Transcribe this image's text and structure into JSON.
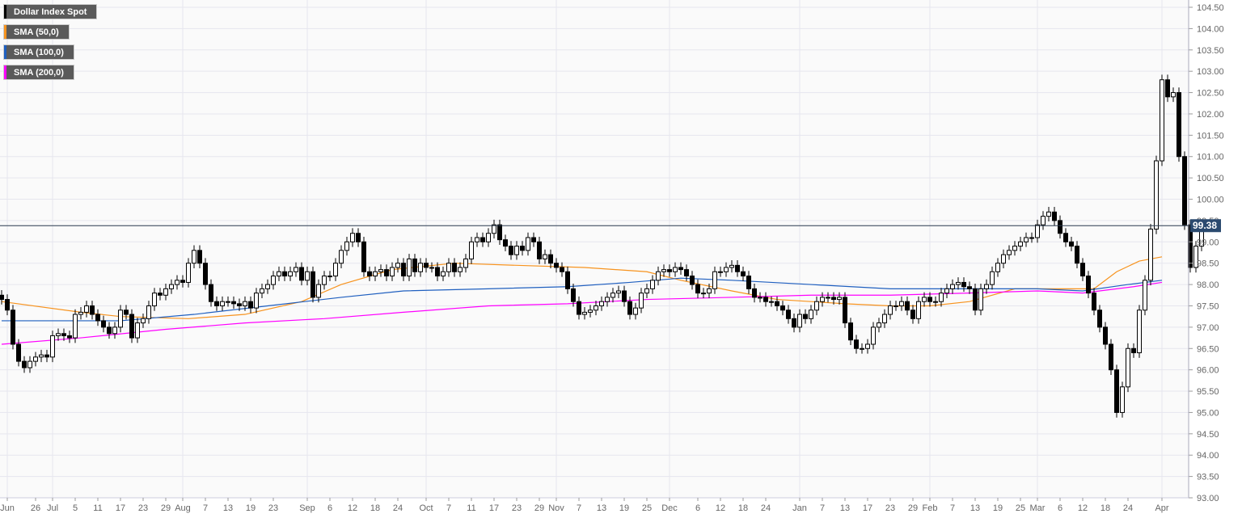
{
  "legend": [
    {
      "label": "Dollar Index Spot",
      "color": "#000000"
    },
    {
      "label": "SMA (50,0)",
      "color": "#f7931e"
    },
    {
      "label": "SMA (100,0)",
      "color": "#1f5fbf"
    },
    {
      "label": "SMA (200,0)",
      "color": "#ff00ff"
    }
  ],
  "current_price": {
    "label": "99.38",
    "value": 99.38,
    "color": "#2b4a6f"
  },
  "chart_data": {
    "type": "candlestick",
    "title": "Dollar Index Spot",
    "ylim": [
      93.0,
      104.5
    ],
    "yticks": [
      "93.00",
      "93.50",
      "94.00",
      "94.50",
      "95.00",
      "95.50",
      "96.00",
      "96.50",
      "97.00",
      "97.50",
      "98.00",
      "98.50",
      "99.00",
      "99.50",
      "100.00",
      "100.50",
      "101.00",
      "101.50",
      "102.00",
      "102.50",
      "103.00",
      "103.50",
      "104.00",
      "104.50"
    ],
    "xticks": [
      [
        "Jun",
        1
      ],
      [
        "26",
        6
      ],
      [
        "Jul",
        9
      ],
      [
        "5",
        13
      ],
      [
        "11",
        17
      ],
      [
        "17",
        21
      ],
      [
        "23",
        25
      ],
      [
        "29",
        29
      ],
      [
        "Aug",
        32
      ],
      [
        "7",
        36
      ],
      [
        "13",
        40
      ],
      [
        "19",
        44
      ],
      [
        "23",
        48
      ],
      [
        "Sep",
        54
      ],
      [
        "6",
        58
      ],
      [
        "12",
        62
      ],
      [
        "18",
        66
      ],
      [
        "24",
        70
      ],
      [
        "Oct",
        75
      ],
      [
        "7",
        79
      ],
      [
        "11",
        83
      ],
      [
        "17",
        87
      ],
      [
        "23",
        91
      ],
      [
        "29",
        95
      ],
      [
        "Nov",
        98
      ],
      [
        "7",
        102
      ],
      [
        "13",
        106
      ],
      [
        "19",
        110
      ],
      [
        "25",
        114
      ],
      [
        "Dec",
        118
      ],
      [
        "6",
        123
      ],
      [
        "12",
        127
      ],
      [
        "18",
        131
      ],
      [
        "24",
        135
      ],
      [
        "Jan",
        141
      ],
      [
        "7",
        145
      ],
      [
        "13",
        149
      ],
      [
        "17",
        153
      ],
      [
        "23",
        157
      ],
      [
        "29",
        161
      ],
      [
        "Feb",
        164
      ],
      [
        "7",
        168
      ],
      [
        "13",
        172
      ],
      [
        "19",
        176
      ],
      [
        "25",
        180
      ],
      [
        "Mar",
        183
      ],
      [
        "6",
        187
      ],
      [
        "12",
        191
      ],
      [
        "18",
        195
      ],
      [
        "24",
        199
      ],
      [
        "Apr",
        205
      ]
    ],
    "closes": [
      97.65,
      97.4,
      96.6,
      96.2,
      96.05,
      96.2,
      96.3,
      96.35,
      96.3,
      96.8,
      96.85,
      96.8,
      96.75,
      97.3,
      97.35,
      97.5,
      97.3,
      97.15,
      97.0,
      96.85,
      97.0,
      97.4,
      97.3,
      96.75,
      97.1,
      97.2,
      97.5,
      97.8,
      97.75,
      97.9,
      98.0,
      98.1,
      98.05,
      98.5,
      98.8,
      98.5,
      98.0,
      97.6,
      97.5,
      97.6,
      97.6,
      97.55,
      97.5,
      97.6,
      97.45,
      97.8,
      97.9,
      98.0,
      98.2,
      98.3,
      98.2,
      98.3,
      98.4,
      98.1,
      98.3,
      97.7,
      98.0,
      98.2,
      98.2,
      98.5,
      98.8,
      99.0,
      99.2,
      99.0,
      98.3,
      98.2,
      98.3,
      98.35,
      98.2,
      98.4,
      98.5,
      98.2,
      98.6,
      98.3,
      98.5,
      98.4,
      98.4,
      98.2,
      98.3,
      98.5,
      98.3,
      98.4,
      98.6,
      99.0,
      99.1,
      99.0,
      99.2,
      99.4,
      99.05,
      98.9,
      98.7,
      98.9,
      98.8,
      99.1,
      99.0,
      98.6,
      98.7,
      98.5,
      98.4,
      98.3,
      97.9,
      97.6,
      97.3,
      97.35,
      97.4,
      97.5,
      97.6,
      97.7,
      97.8,
      97.85,
      97.6,
      97.3,
      97.45,
      97.8,
      97.9,
      98.1,
      98.3,
      98.35,
      98.3,
      98.4,
      98.35,
      98.2,
      98.0,
      97.8,
      97.8,
      97.9,
      98.3,
      98.3,
      98.4,
      98.45,
      98.3,
      98.2,
      97.9,
      97.7,
      97.7,
      97.6,
      97.6,
      97.5,
      97.4,
      97.2,
      97.0,
      97.3,
      97.2,
      97.4,
      97.6,
      97.7,
      97.7,
      97.65,
      97.7,
      97.1,
      96.7,
      96.5,
      96.5,
      96.6,
      97.0,
      97.1,
      97.3,
      97.5,
      97.5,
      97.6,
      97.4,
      97.2,
      97.6,
      97.7,
      97.6,
      97.6,
      97.8,
      97.9,
      98.0,
      98.05,
      97.95,
      97.9,
      97.4,
      97.9,
      98.0,
      98.3,
      98.5,
      98.7,
      98.8,
      98.9,
      99.0,
      99.1,
      99.1,
      99.4,
      99.6,
      99.7,
      99.5,
      99.2,
      99.0,
      98.9,
      98.5,
      98.2,
      97.8,
      97.4,
      97.0,
      96.6,
      96.0,
      95.0,
      95.6,
      96.5,
      96.4,
      97.4,
      98.1,
      99.3,
      100.9,
      102.8,
      102.4,
      102.5,
      101.0,
      99.4,
      98.4,
      98.9,
      99.38
    ],
    "series": [
      {
        "name": "SMA (50,0)",
        "color": "#f7931e",
        "points": [
          [
            0,
            97.6
          ],
          [
            14,
            97.35
          ],
          [
            21,
            97.25
          ],
          [
            33,
            97.2
          ],
          [
            43,
            97.3
          ],
          [
            53,
            97.6
          ],
          [
            60,
            98.0
          ],
          [
            69,
            98.35
          ],
          [
            80,
            98.5
          ],
          [
            91,
            98.45
          ],
          [
            103,
            98.4
          ],
          [
            114,
            98.3
          ],
          [
            120,
            98.1
          ],
          [
            129,
            97.85
          ],
          [
            137,
            97.65
          ],
          [
            149,
            97.55
          ],
          [
            157,
            97.5
          ],
          [
            164,
            97.5
          ],
          [
            171,
            97.6
          ],
          [
            179,
            97.9
          ],
          [
            186,
            97.9
          ],
          [
            193,
            97.9
          ],
          [
            197,
            98.3
          ],
          [
            201,
            98.55
          ],
          [
            205,
            98.65
          ]
        ]
      },
      {
        "name": "SMA (100,0)",
        "color": "#1f5fbf",
        "points": [
          [
            0,
            97.15
          ],
          [
            21,
            97.15
          ],
          [
            34,
            97.3
          ],
          [
            47,
            97.5
          ],
          [
            60,
            97.7
          ],
          [
            71,
            97.85
          ],
          [
            86,
            97.9
          ],
          [
            100,
            97.95
          ],
          [
            111,
            98.05
          ],
          [
            120,
            98.15
          ],
          [
            129,
            98.1
          ],
          [
            143,
            98.0
          ],
          [
            157,
            97.9
          ],
          [
            171,
            97.9
          ],
          [
            183,
            97.9
          ],
          [
            191,
            97.85
          ],
          [
            199,
            98.0
          ],
          [
            205,
            98.1
          ]
        ]
      },
      {
        "name": "SMA (200,0)",
        "color": "#ff00ff",
        "points": [
          [
            0,
            96.6
          ],
          [
            14,
            96.75
          ],
          [
            29,
            96.95
          ],
          [
            43,
            97.1
          ],
          [
            57,
            97.2
          ],
          [
            71,
            97.35
          ],
          [
            86,
            97.5
          ],
          [
            100,
            97.55
          ],
          [
            114,
            97.65
          ],
          [
            129,
            97.7
          ],
          [
            143,
            97.75
          ],
          [
            157,
            97.75
          ],
          [
            171,
            97.8
          ],
          [
            183,
            97.85
          ],
          [
            191,
            97.8
          ],
          [
            200,
            97.95
          ],
          [
            205,
            98.05
          ]
        ]
      }
    ]
  }
}
